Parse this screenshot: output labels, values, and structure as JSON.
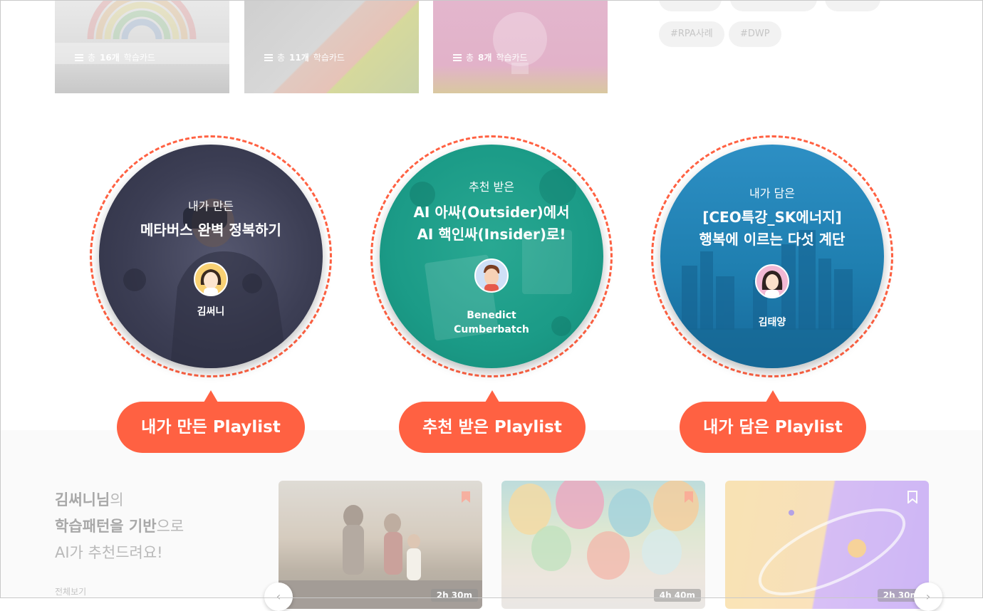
{
  "top": {
    "cards": [
      {
        "count_prefix": "총",
        "count": "16개",
        "count_suffix": "학습카드"
      },
      {
        "count_prefix": "총",
        "count": "11개",
        "count_suffix": "학습카드"
      },
      {
        "count_prefix": "총",
        "count": "8개",
        "count_suffix": "학습카드"
      }
    ],
    "tags": [
      "#RPA사례",
      "#DWP"
    ]
  },
  "playlists": [
    {
      "sub": "내가 만든",
      "title_lines": [
        "메타버스 완벽 정복하기"
      ],
      "author": [
        "김써니"
      ],
      "button": "내가 만든 Playlist",
      "color": "#3a3d52"
    },
    {
      "sub": "추천 받은",
      "title_lines": [
        "AI 아싸(Outsider)에서",
        "AI 핵인싸(Insider)로!"
      ],
      "author": [
        "Benedict",
        "Cumberbatch"
      ],
      "button": "추천 받은 Playlist",
      "color": "#1e9a87"
    },
    {
      "sub": "내가 담은",
      "title_lines": [
        "[CEO특강_SK에너지]",
        "행복에 이르는 다섯 계단"
      ],
      "author": [
        "김태양"
      ],
      "button": "내가 담은 Playlist",
      "color": "#1f7fb0"
    }
  ],
  "recommend": {
    "line1_bold": "김써니님",
    "line1_rest": "의",
    "line2_bold": "학습패턴을 기반",
    "line2_rest": "으로",
    "line3": "AI가 추천드려요!",
    "see_all": "전체보기",
    "cards": [
      {
        "duration": "2h 30m"
      },
      {
        "duration": "4h 40m"
      },
      {
        "duration": "2h 30m"
      }
    ],
    "prev_icon": "chevron-left-icon",
    "next_icon": "chevron-right-icon"
  },
  "colors": {
    "accent": "#ff6142"
  }
}
